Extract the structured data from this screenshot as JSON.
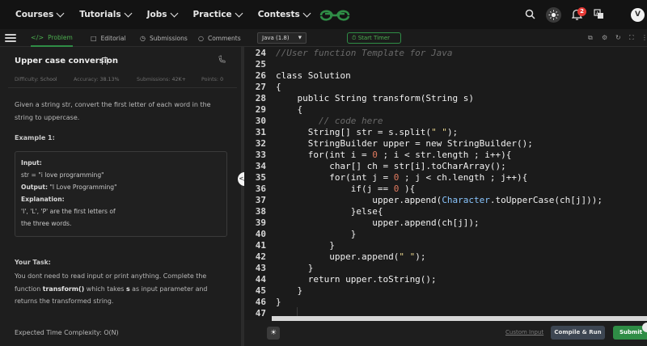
{
  "nav": {
    "items": [
      "Courses",
      "Tutorials",
      "Jobs",
      "Practice",
      "Contests"
    ],
    "notification_count": "2",
    "avatar_letter": "V"
  },
  "tabs": {
    "problem": "Problem",
    "editorial": "Editorial",
    "submissions": "Submissions",
    "comments": "Comments"
  },
  "editor_toolbar": {
    "language": "Java (1.8)",
    "timer_label": "Start Timer"
  },
  "problem": {
    "title": "Upper case conversion",
    "difficulty_label": "Difficulty:",
    "difficulty": "School",
    "accuracy_label": "Accuracy:",
    "accuracy": "38.13%",
    "submissions_label": "Submissions:",
    "submissions": "42K+",
    "points_label": "Points:",
    "points": "0",
    "description_1": "Given a string str, convert the first letter of each word in the",
    "description_2": "string to uppercase.",
    "example_heading": "Example 1:",
    "input_label": "Input:",
    "input_value": "str = \"i  love  programming\"",
    "output_label": "Output:",
    "output_value": "\"I  Love  Programming\"",
    "explanation_label": "Explanation:",
    "explanation_1": "'I',  'L',  'P'  are  the  first  letters  of",
    "explanation_2": "the  three  words.",
    "task_heading": "Your Task:",
    "task_1": "You dont need to read input or print anything. Complete the",
    "task_2_pre": "function ",
    "task_2_fn": "transform()",
    "task_2_mid": " which takes ",
    "task_2_s": "s",
    "task_2_post": " as input parameter and",
    "task_3": "returns the transformed string.",
    "complexity_label": "Expected Time Complexity:",
    "complexity": "O(N)"
  },
  "code": {
    "line_numbers": [
      "24",
      "25",
      "26",
      "27",
      "28",
      "29",
      "30",
      "31",
      "32",
      "33",
      "34",
      "35",
      "36",
      "37",
      "38",
      "39",
      "40",
      "41",
      "42",
      "43",
      "44",
      "45",
      "46",
      "47"
    ]
  },
  "bottom": {
    "custom_input": "Custom Input",
    "compile_run": "Compile & Run",
    "submit": "Submit"
  },
  "colors": {
    "brand_green": "#2f8d46",
    "keyword": "#f0f0f0",
    "number": "#e07a5f",
    "string": "#e6d28a",
    "comment": "#6a6a6a"
  },
  "icons": {
    "search": "search-icon",
    "theme": "sun-icon",
    "bell": "bell-icon",
    "translate": "translate-icon"
  }
}
